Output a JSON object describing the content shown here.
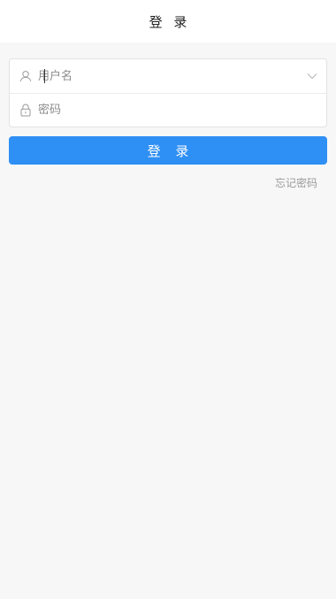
{
  "header": {
    "title": "登 录"
  },
  "form": {
    "username": {
      "placeholder": "用户名",
      "value": "",
      "icon": "user-icon",
      "dropdown_icon": "chevron-down-icon"
    },
    "password": {
      "placeholder": "密码",
      "value": "",
      "icon": "lock-icon"
    }
  },
  "actions": {
    "login_label": "登 录",
    "forgot_label": "忘记密码"
  },
  "colors": {
    "accent": "#2e8ff5",
    "background": "#f7f7f7",
    "surface": "#ffffff",
    "muted_text": "#9b9b9b"
  }
}
